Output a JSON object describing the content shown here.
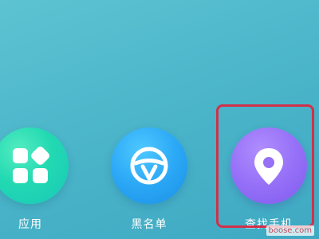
{
  "apps": [
    {
      "label": "应用",
      "icon": "apps-grid-icon",
      "color": "#22d9b2"
    },
    {
      "label": "黑名单",
      "icon": "blacklist-icon",
      "color": "#2ba8f6"
    },
    {
      "label": "查找手机",
      "icon": "location-pin-icon",
      "color": "#9670f7"
    }
  ],
  "highlight_color": "#d2304a",
  "watermark": "boose.com"
}
